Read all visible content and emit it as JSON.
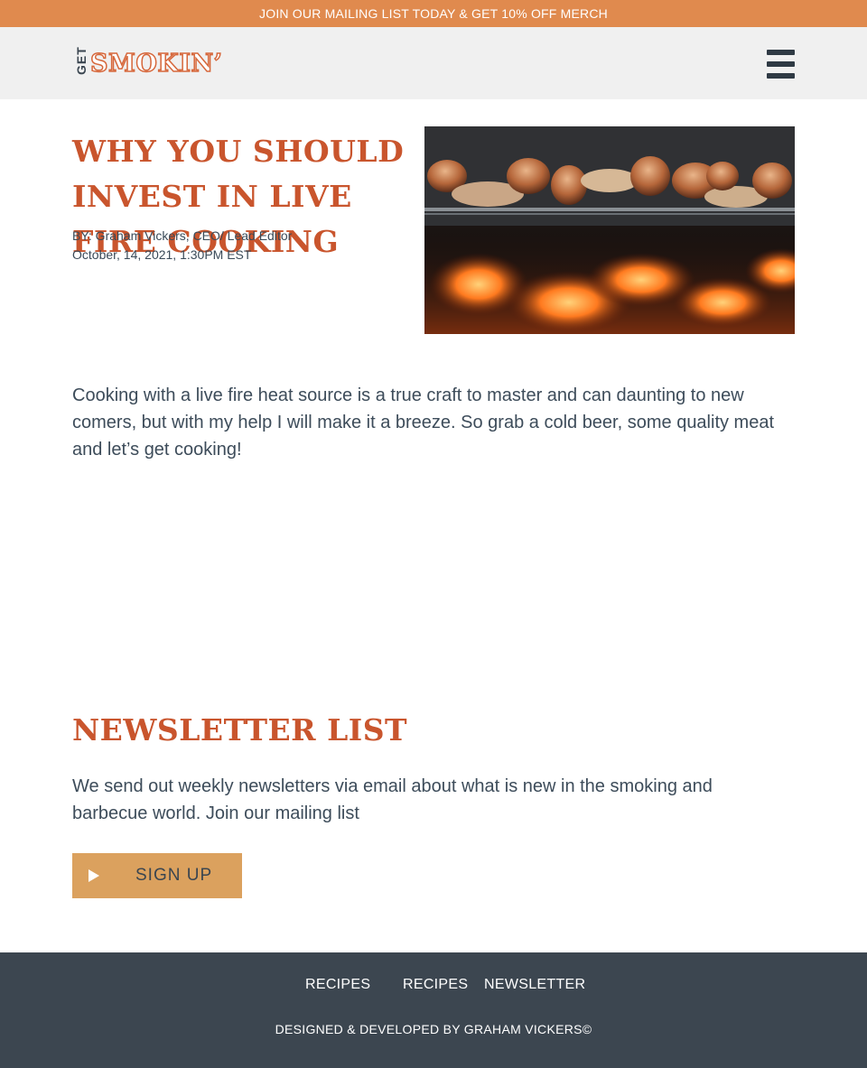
{
  "promo_banner": {
    "text": "JOIN OUR MAILING LIST TODAY & GET 10% OFF MERCH"
  },
  "header": {
    "logo": {
      "get": "GET",
      "smokin": "SMOKIN’"
    },
    "menu_icon": "hamburger-menu-icon"
  },
  "article": {
    "title": "WHY YOU SHOULD INVEST IN LIVE FIRE COOKING",
    "author": "BY: Graham Vickers, CEO/ Lead Editor",
    "date": "October, 14, 2021, 1:30PM EST",
    "intro": "Cooking with a live fire heat source is a true craft to master and can daunting to new comers, but with my help I will make it a breeze. So grab a cold beer, some quality meat and let’s get cooking!"
  },
  "newsletter": {
    "title": "NEWSLETTER LIST",
    "text": "We send out weekly newsletters via email about what is new in the smoking and barbecue world. Join our mailing list",
    "button_label": "SIGN UP",
    "button_icon": "play-icon"
  },
  "footer": {
    "links": [
      "RECIPES",
      "RECIPES",
      "NEWSLETTER"
    ],
    "credits": "DESIGNED & DEVELOPED BY GRAHAM VICKERS©"
  },
  "colors": {
    "promo_bg": "#e08a4e",
    "header_bg": "#f0f0f0",
    "accent": "#c9552d",
    "button_bg": "#dba15e",
    "footer_bg": "#3c4650"
  }
}
